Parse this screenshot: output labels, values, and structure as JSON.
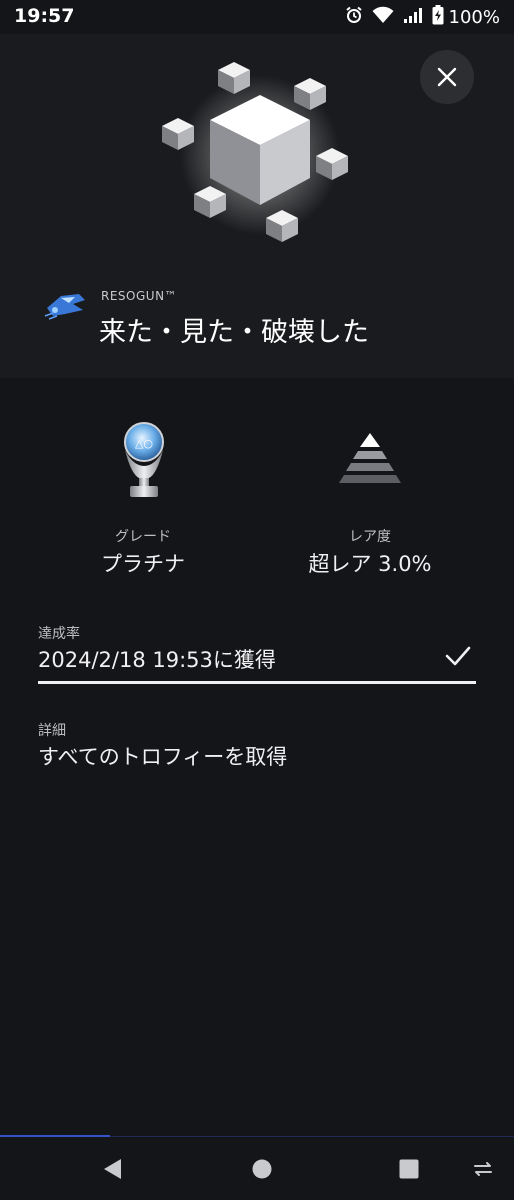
{
  "status_bar": {
    "time": "19:57",
    "battery": "100%",
    "icons": [
      "alarm-icon",
      "wifi-icon",
      "signal-icon",
      "battery-charging-icon"
    ]
  },
  "trophy": {
    "game_name": "RESOGUN™",
    "title": "来た・見た・破壊した"
  },
  "stats": {
    "grade_label": "グレード",
    "grade_value": "プラチナ",
    "rarity_label": "レア度",
    "rarity_value": "超レア 3.0%"
  },
  "progress": {
    "label": "達成率",
    "value": "2024/2/18  19:53に獲得",
    "fraction": 1.0
  },
  "details": {
    "label": "詳細",
    "value": "すべてのトロフィーを取得"
  },
  "nav": {
    "icons": [
      "back-triangle-icon",
      "home-circle-icon",
      "recents-square-icon",
      "rotate-icon"
    ]
  },
  "colors": {
    "background": "#141518",
    "hero_background": "#1a1b1e",
    "accent": "#3553c8"
  }
}
